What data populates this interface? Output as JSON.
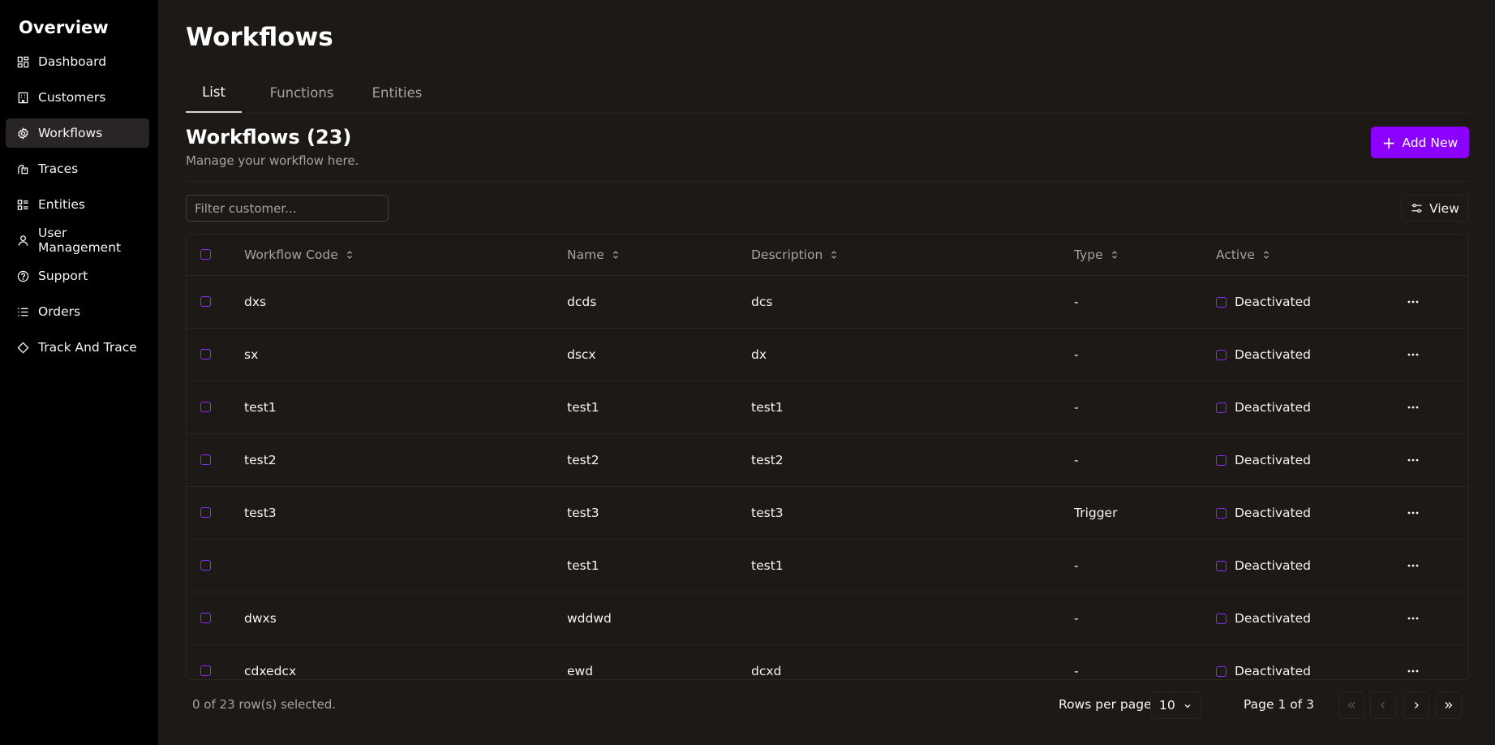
{
  "sidebar": {
    "title": "Overview",
    "items": [
      {
        "label": "Dashboard",
        "icon": "dashboard-icon"
      },
      {
        "label": "Customers",
        "icon": "building-icon"
      },
      {
        "label": "Workflows",
        "icon": "gear-icon",
        "active": true
      },
      {
        "label": "Traces",
        "icon": "traces-icon"
      },
      {
        "label": "Entities",
        "icon": "entities-icon"
      },
      {
        "label": "User Management",
        "icon": "user-icon"
      },
      {
        "label": "Support",
        "icon": "help-icon"
      },
      {
        "label": "Orders",
        "icon": "list-icon"
      },
      {
        "label": "Track And Trace",
        "icon": "diamond-icon"
      }
    ]
  },
  "page": {
    "title": "Workflows"
  },
  "tabs": [
    {
      "label": "List",
      "active": true
    },
    {
      "label": "Functions"
    },
    {
      "label": "Entities"
    }
  ],
  "section": {
    "title": "Workflows (23)",
    "subtitle": "Manage your workflow here.",
    "add_label": "Add New"
  },
  "filter": {
    "placeholder": "Filter customer..."
  },
  "view_label": "View",
  "table": {
    "columns": [
      "Workflow Code",
      "Name",
      "Description",
      "Type",
      "Active"
    ],
    "rows": [
      {
        "code": "dxs",
        "name": "dcds",
        "description": "dcs",
        "type": "-",
        "active": "Deactivated"
      },
      {
        "code": "sx",
        "name": "dscx",
        "description": "dx",
        "type": "-",
        "active": "Deactivated"
      },
      {
        "code": "test1",
        "name": "test1",
        "description": "test1",
        "type": "-",
        "active": "Deactivated"
      },
      {
        "code": "test2",
        "name": "test2",
        "description": "test2",
        "type": "-",
        "active": "Deactivated"
      },
      {
        "code": "test3",
        "name": "test3",
        "description": "test3",
        "type": "Trigger",
        "active": "Deactivated"
      },
      {
        "code": "",
        "name": "test1",
        "description": "test1",
        "type": "-",
        "active": "Deactivated"
      },
      {
        "code": "dwxs",
        "name": "wddwd",
        "description": "",
        "type": "-",
        "active": "Deactivated"
      },
      {
        "code": "cdxedcx",
        "name": "ewd",
        "description": "dcxd",
        "type": "-",
        "active": "Deactivated"
      }
    ]
  },
  "footer": {
    "selection": "0 of 23 row(s) selected.",
    "rows_per_page_label": "Rows per page",
    "rows_per_page_value": "10",
    "page_info": "Page 1 of 3"
  },
  "colors": {
    "accent": "#8b00ff",
    "background": "#1c1917",
    "sidebar": "#000000",
    "border": "#292524"
  }
}
